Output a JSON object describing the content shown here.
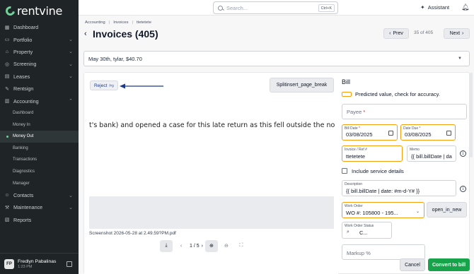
{
  "app": {
    "logo_text": "rentvine"
  },
  "sidebar": {
    "items": [
      {
        "label": "Dashboard",
        "icon": "dashboard-icon",
        "chevron": false
      },
      {
        "label": "Portfolio",
        "icon": "folder-icon",
        "chevron": true
      },
      {
        "label": "Property",
        "icon": "building-icon",
        "chevron": true
      },
      {
        "label": "Screening",
        "icon": "screening-icon",
        "chevron": true
      },
      {
        "label": "Leases",
        "icon": "lease-icon",
        "chevron": true
      },
      {
        "label": "Rentsign",
        "icon": "sign-icon",
        "chevron": false
      },
      {
        "label": "Accounting",
        "icon": "accounting-icon",
        "chevron": true
      }
    ],
    "accounting_sub": [
      {
        "label": "Dashboard",
        "active": false
      },
      {
        "label": "Money In",
        "active": false
      },
      {
        "label": "Money Out",
        "active": true
      },
      {
        "label": "Banking",
        "active": false
      },
      {
        "label": "Transactions",
        "active": false
      },
      {
        "label": "Diagnostics",
        "active": false
      },
      {
        "label": "Manager",
        "active": false
      }
    ],
    "bottom_items": [
      {
        "label": "Contacts",
        "icon": "contacts-icon",
        "chevron": true
      },
      {
        "label": "Maintenance",
        "icon": "wrench-icon",
        "chevron": true
      },
      {
        "label": "Reports",
        "icon": "reports-icon",
        "chevron": false
      }
    ],
    "user": {
      "initials": "FP",
      "name": "Fredlyn Pabalinas",
      "time": "1:23 PM"
    }
  },
  "topbar": {
    "search_placeholder": "Search...",
    "search_shortcut": "Ctrl+K",
    "assistant_label": "Assistant"
  },
  "header": {
    "breadcrumb": [
      "Accounting",
      "Invoices",
      "ttetetete"
    ],
    "title": "Invoices (405)",
    "prev_label": "Prev",
    "next_label": "Next",
    "counter": "35 of 405"
  },
  "select_bar": {
    "value": "May 30th, tylar, $40.70"
  },
  "document": {
    "reject_label": "Reject",
    "split_label": "Splitinsert_page_break",
    "text_line": "t's bank) and opened a case for this late return as this fell outside the norma",
    "filename": "Screenshot 2026-05-28 at 2.49.59?PM.pdf",
    "page_indicator": "1 / 5"
  },
  "bill": {
    "title": "Bill",
    "legend": "Predicted value, check for accuracy.",
    "payee_placeholder": "Payee",
    "bill_date_label": "Bill Date",
    "bill_date": "03/08/2025",
    "date_due_label": "Date Due",
    "date_due": "03/08/2025",
    "invoice_label": "Invoice / Ref #",
    "invoice_value": "ttetetete",
    "memo_label": "Memo",
    "memo_value": "{{ bill.billDate | da",
    "include_services": "Include service details",
    "description_label": "Description",
    "description_value": "{{ bill.billDate | date: #m-d-Y# }}",
    "work_order_label": "Work Order",
    "work_order_value": "WO #: 105800 - 195...",
    "open_label": "open_in_new",
    "work_order_status_label": "Work Order Status",
    "work_order_status_value": "C...",
    "markup_placeholder": "Markup %",
    "cancel_label": "Cancel",
    "convert_label": "Convert to bill"
  },
  "colors": {
    "sidebar_bg": "#1f2426",
    "accent_green": "#16a34a",
    "predicted_border": "#f59e0b",
    "arrow": "#1e3a8a"
  }
}
